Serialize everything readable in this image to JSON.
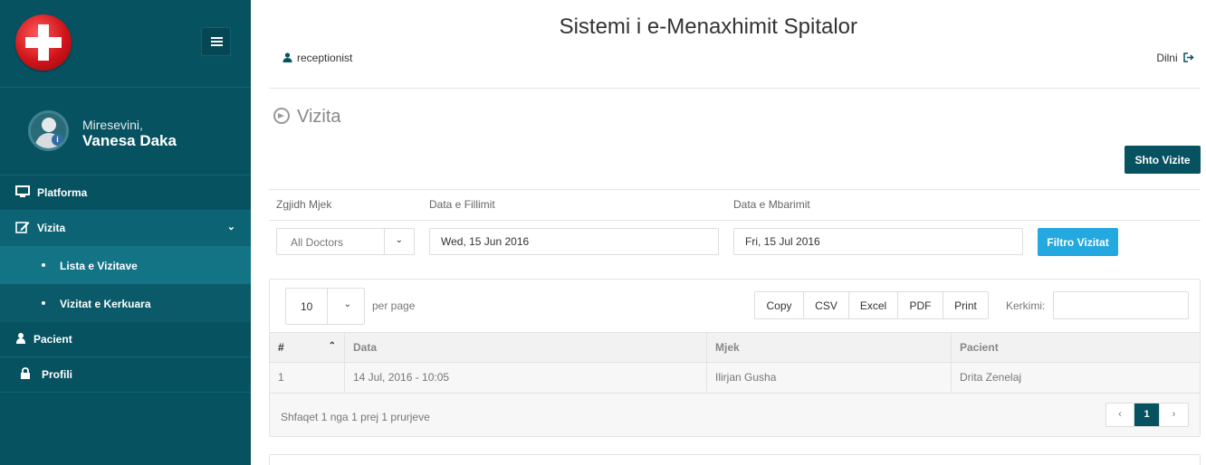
{
  "sidebar": {
    "welcome": "Miresevini,",
    "username": "Vanesa Daka",
    "items": [
      {
        "label": "Platforma",
        "icon": "monitor-icon"
      },
      {
        "label": "Vizita",
        "icon": "edit-icon"
      },
      {
        "label": "Pacient",
        "icon": "user-icon"
      },
      {
        "label": "Profili",
        "icon": "lock-icon"
      }
    ],
    "subitems": [
      {
        "label": "Lista e Vizitave"
      },
      {
        "label": "Vizitat e Kerkuara"
      }
    ]
  },
  "header": {
    "title": "Sistemi i e-Menaxhimit Spitalor",
    "role": "receptionist",
    "logout": "Dilni"
  },
  "page": {
    "title": "Vizita",
    "add_button": "Shto Vizite"
  },
  "filters": {
    "doctor_label": "Zgjidh Mjek",
    "start_label": "Data e Fillimit",
    "end_label": "Data e Mbarimit",
    "doctor_value": "All Doctors",
    "start_value": "Wed, 15 Jun 2016",
    "end_value": "Fri, 15 Jul 2016",
    "filter_button": "Filtro Vizitat"
  },
  "table": {
    "per_page_value": "10",
    "per_page_label": "per page",
    "export_buttons": [
      "Copy",
      "CSV",
      "Excel",
      "PDF",
      "Print"
    ],
    "search_label": "Kerkimi:",
    "columns": [
      "#",
      "Data",
      "Mjek",
      "Pacient"
    ],
    "rows": [
      [
        "1",
        "14 Jul, 2016 - 10:05",
        "Ilirjan Gusha",
        "Drita Zenelaj"
      ]
    ],
    "footer_info": "Shfaqet 1 nga 1 prej 1 prurjeve",
    "pagination": {
      "prev": "‹",
      "current": "1",
      "next": "›"
    }
  },
  "colors": {
    "sidebar": "#075261",
    "accent": "#23a8e0"
  }
}
